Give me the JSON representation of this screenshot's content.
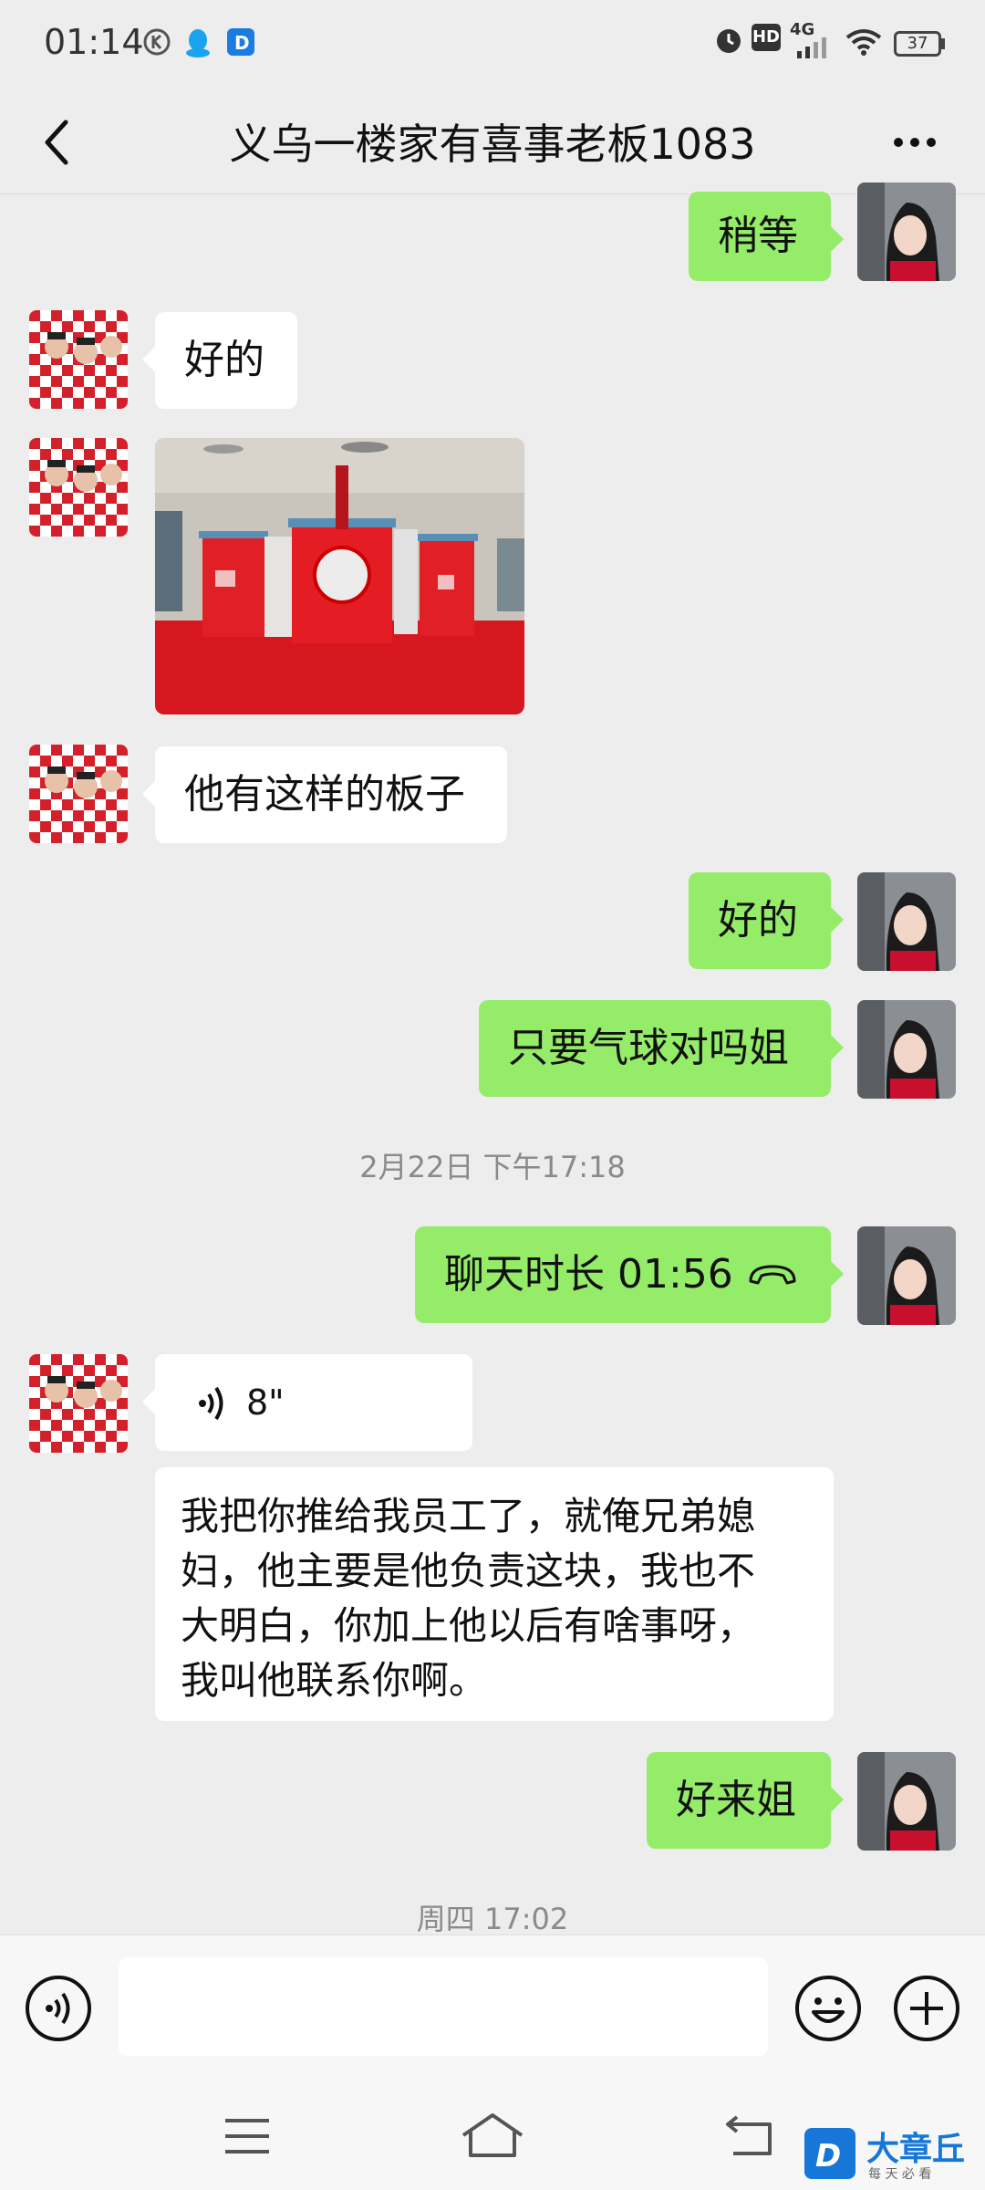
{
  "status_bar": {
    "time": "01:14",
    "network": "4G",
    "hd": "HD",
    "battery": "37",
    "icons": [
      "k-circle-icon",
      "qq-penguin-icon",
      "d-app-icon",
      "alarm-icon",
      "hd-icon",
      "signal-icon",
      "wifi-icon",
      "battery-icon"
    ]
  },
  "header": {
    "title": "义乌一楼家有喜事老板1083"
  },
  "messages": [
    {
      "from": "me",
      "text": "稍等"
    },
    {
      "from": "them",
      "text": "好的"
    },
    {
      "from": "them",
      "type": "image"
    },
    {
      "from": "them",
      "text": "他有这样的板子"
    },
    {
      "from": "me",
      "text": "好的"
    },
    {
      "from": "me",
      "text": "只要气球对吗姐"
    },
    {
      "type": "timestamp",
      "text": "2月22日 下午17:18"
    },
    {
      "from": "me",
      "type": "call",
      "text": "聊天时长 01:56"
    },
    {
      "from": "them",
      "type": "voice",
      "text": "8\""
    },
    {
      "from": "them",
      "lines": [
        "我把你推给我员工了，就俺兄弟媳",
        "妇，他主要是他负责这块，我也不",
        "大明白，你加上他以后有啥事呀，",
        "我叫他联系你啊。"
      ]
    },
    {
      "from": "me",
      "text": "好来姐"
    },
    {
      "type": "timestamp",
      "text": "周四 17:02"
    }
  ],
  "watermark": {
    "brand": "大章丘",
    "slogan": "每 天 必 看"
  },
  "colors": {
    "outgoing_bubble": "#95ec69",
    "incoming_bubble": "#ffffff",
    "background": "#ededed"
  }
}
